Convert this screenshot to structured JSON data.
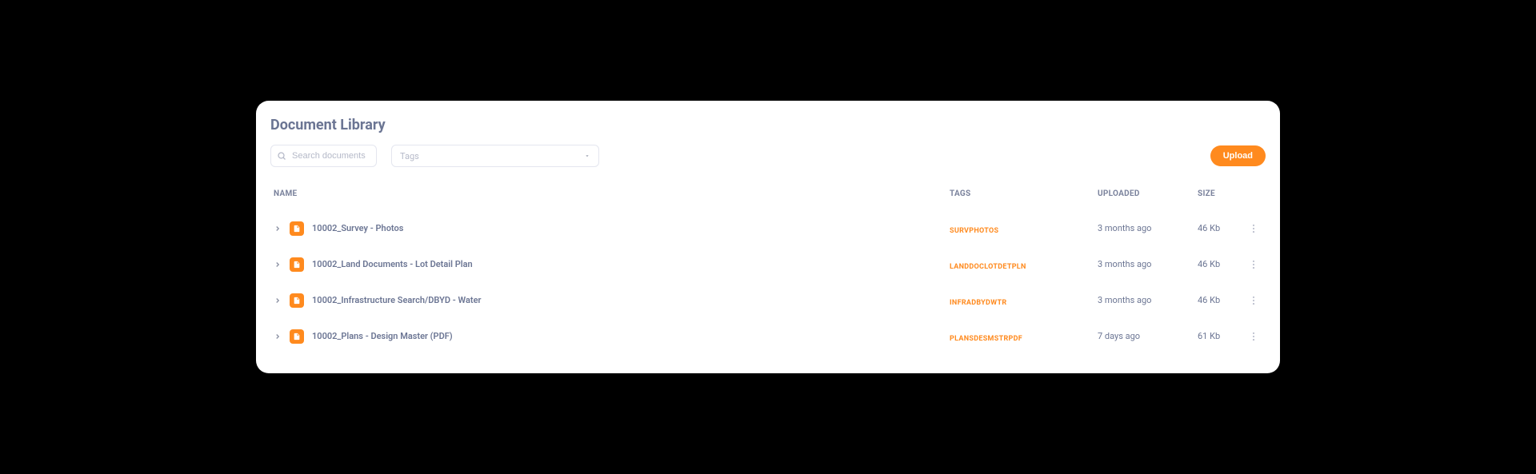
{
  "title": "Document Library",
  "search": {
    "placeholder": "Search documents"
  },
  "tags_filter": {
    "placeholder": "Tags"
  },
  "upload_button": "Upload",
  "columns": {
    "name": "NAME",
    "tags": "TAGS",
    "uploaded": "UPLOADED",
    "size": "SIZE"
  },
  "rows": [
    {
      "name": "10002_Survey - Photos",
      "tag": "SURVPHOTOS",
      "uploaded": "3 months ago",
      "size": "46 Kb"
    },
    {
      "name": "10002_Land Documents - Lot Detail Plan",
      "tag": "LANDDOCLOTDETPLN",
      "uploaded": "3 months ago",
      "size": "46 Kb"
    },
    {
      "name": "10002_Infrastructure Search/DBYD - Water",
      "tag": "INFRADBYDWTR",
      "uploaded": "3 months ago",
      "size": "46 Kb"
    },
    {
      "name": "10002_Plans - Design Master (PDF)",
      "tag": "PLANSDESMSTRPDF",
      "uploaded": "7 days ago",
      "size": "61 Kb"
    }
  ]
}
